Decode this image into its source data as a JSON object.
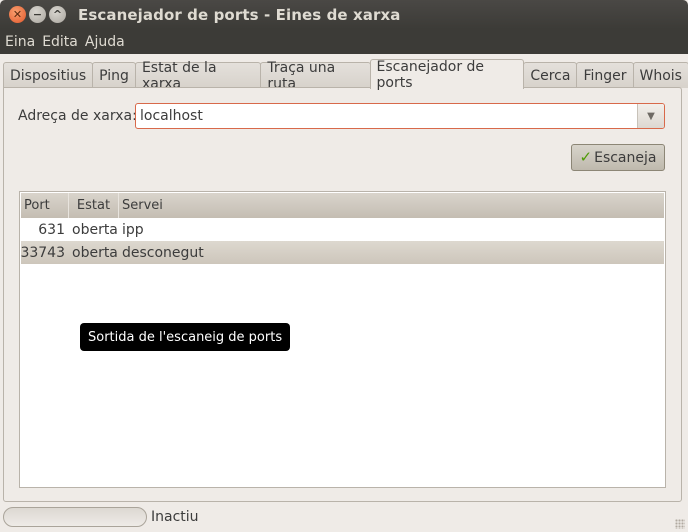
{
  "window": {
    "title": "Escanejador de ports - Eines de xarxa",
    "controls": [
      "close",
      "minimize",
      "maximize"
    ]
  },
  "menu": [
    "Eina",
    "Edita",
    "Ajuda"
  ],
  "tabs": [
    {
      "label": "Dispositius",
      "active": false
    },
    {
      "label": "Ping",
      "active": false
    },
    {
      "label": "Estat de la xarxa",
      "active": false
    },
    {
      "label": "Traça una ruta",
      "active": false
    },
    {
      "label": "Escanejador de ports",
      "active": true
    },
    {
      "label": "Cerca",
      "active": false
    },
    {
      "label": "Finger",
      "active": false
    },
    {
      "label": "Whois",
      "active": false
    }
  ],
  "scanner": {
    "address_label": "Adreça de xarxa:",
    "address_value": "localhost",
    "scan_button": "Escaneja",
    "columns": [
      "Port",
      "Estat",
      "Servei"
    ],
    "rows": [
      {
        "port": "631",
        "state": "oberta",
        "service": "ipp"
      },
      {
        "port": "33743",
        "state": "oberta",
        "service": "desconegut"
      }
    ],
    "tooltip": "Sortida de l'escaneig de ports"
  },
  "statusbar": {
    "text": "Inactiu",
    "progress": 0
  },
  "colors": {
    "titlebar": "#3c3b37",
    "window_bg": "#efebe7",
    "focus_border": "#d8694a",
    "check_icon": "#4e9a06"
  }
}
